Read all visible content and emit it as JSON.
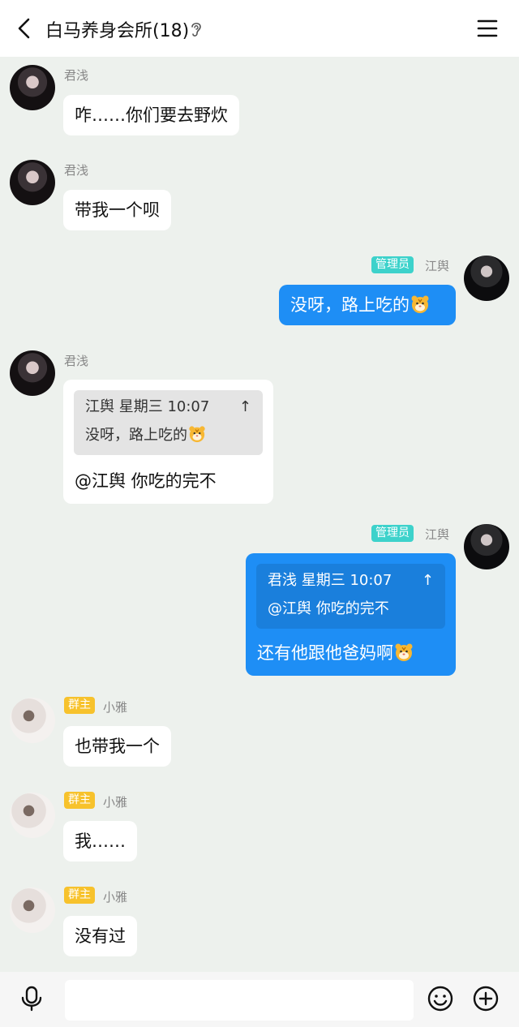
{
  "header": {
    "title": "白马养身会所(18)",
    "icons": [
      "back-icon",
      "ear-icon",
      "menu-icon"
    ]
  },
  "messages": [
    {
      "side": "in",
      "sender": "君浅",
      "avatar": "avatar-junqian",
      "text": "咋……你们要去野炊"
    },
    {
      "side": "in",
      "sender": "君浅",
      "avatar": "avatar-junqian",
      "text": "带我一个呗"
    },
    {
      "side": "out",
      "sender": "江舆",
      "badge": "管理员",
      "avatar": "avatar-jiangyu",
      "text": "没呀，路上吃的",
      "emoji": "tiger-emoji"
    },
    {
      "side": "in",
      "sender": "君浅",
      "avatar": "avatar-junqian",
      "quote": {
        "header": "江舆 星期三 10:07",
        "text": "没呀，路上吃的",
        "emoji": "tiger-emoji"
      },
      "text": "@江舆 你吃的完不"
    },
    {
      "side": "out",
      "sender": "江舆",
      "badge": "管理员",
      "avatar": "avatar-jiangyu",
      "quote": {
        "header": "君浅 星期三 10:07",
        "text": "@江舆 你吃的完不"
      },
      "text": "还有他跟他爸妈啊",
      "emoji": "tiger-emoji"
    },
    {
      "side": "in",
      "sender": "小雅",
      "badge": "群主",
      "avatar": "avatar-xiaoya",
      "text": "也带我一个"
    },
    {
      "side": "in",
      "sender": "小雅",
      "badge": "群主",
      "avatar": "avatar-xiaoya",
      "text": "我……"
    },
    {
      "side": "in",
      "sender": "小雅",
      "badge": "群主",
      "avatar": "avatar-xiaoya",
      "text": "没有过"
    }
  ],
  "quote_arrow": "↑",
  "input": {
    "value": "",
    "placeholder": ""
  },
  "bottom_icons": [
    "mic-icon",
    "emoji-icon",
    "plus-icon"
  ],
  "colors": {
    "background": "#edf1ed",
    "outgoing_bubble": "#1e8ef5",
    "admin_badge": "#3dd2cb",
    "owner_badge": "#f7c22c"
  }
}
